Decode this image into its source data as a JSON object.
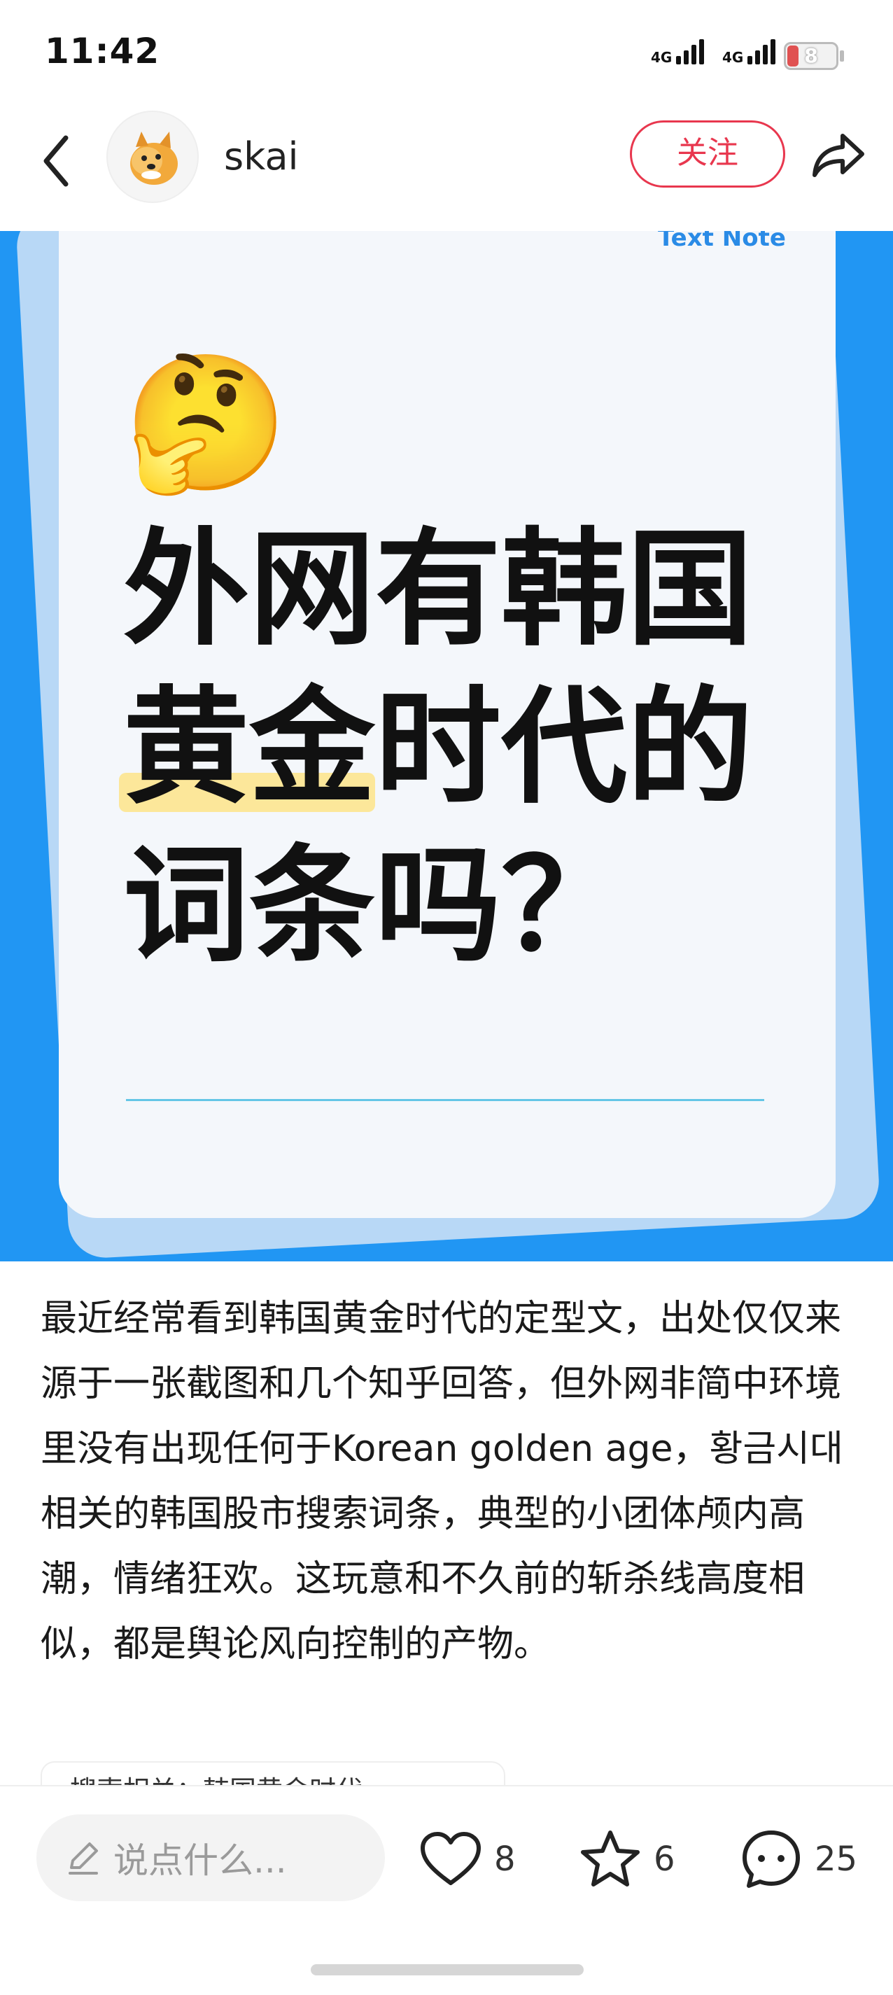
{
  "status_bar": {
    "time": "11:42",
    "network_1": "4G",
    "network_2": "4G",
    "battery": "8"
  },
  "header": {
    "username": "skai",
    "follow_label": "关注"
  },
  "image_card": {
    "brand": "Text Note",
    "emoji": "🤔",
    "line1": "外网有韩国",
    "line2_highlight": "黄金",
    "line2_rest": "时代的",
    "line3": "词条吗？"
  },
  "post": {
    "text": "最近经常看到韩国黄金时代的定型文，出处仅仅来源于一张截图和几个知乎回答，但外网非简中环境里没有出现任何于Korean golden age，황금시대相关的韩国股市搜索词条，典型的小团体颅内高潮，情绪狂欢。这玩意和不久前的斩杀线高度相似，都是舆论风向控制的产物。",
    "topic_tag": "搜索相关：韩国黄金时代"
  },
  "bottom_bar": {
    "comment_placeholder": "说点什么...",
    "likes": "8",
    "favorites": "6",
    "comments": "25"
  },
  "colors": {
    "accent": "#e8374e",
    "image_bg": "#2196f3",
    "highlight": "#fce79a"
  }
}
